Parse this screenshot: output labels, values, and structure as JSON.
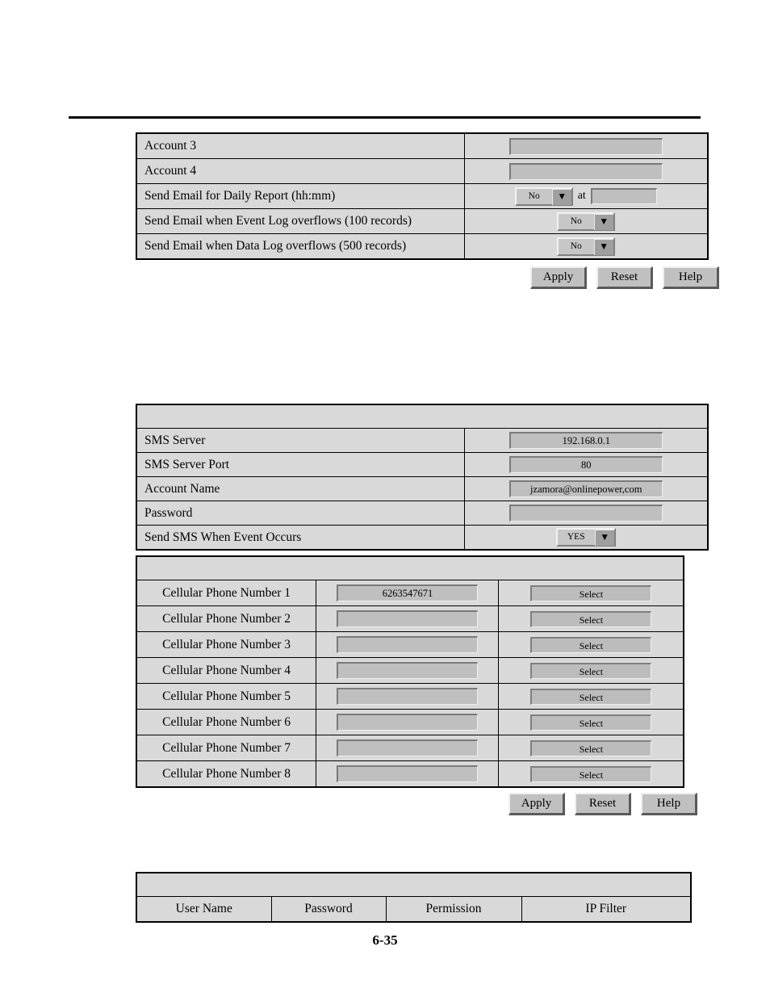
{
  "page": {
    "number": "6-35"
  },
  "email_table": {
    "rows": [
      {
        "label": "Account 3",
        "control": "textbox",
        "value": ""
      },
      {
        "label": "Account 4",
        "control": "textbox",
        "value": ""
      },
      {
        "label": "Send Email for Daily Report (hh:mm)",
        "control": "dropdown-time",
        "value": "No",
        "at_label": "at",
        "time_value": ""
      },
      {
        "label": "Send Email when Event Log overflows (100 records)",
        "control": "dropdown",
        "value": "No"
      },
      {
        "label": "Send Email when Data Log overflows (500 records)",
        "control": "dropdown",
        "value": "No"
      }
    ],
    "buttons": {
      "apply": "Apply",
      "reset": "Reset",
      "help": "Help"
    }
  },
  "sms_table": {
    "title": "",
    "rows": [
      {
        "label": "SMS Server",
        "control": "textbox",
        "value": "192.168.0.1"
      },
      {
        "label": "SMS Server Port",
        "control": "textbox",
        "value": "80"
      },
      {
        "label": "Account Name",
        "control": "textbox",
        "value": "jzamora@onlinepower,com"
      },
      {
        "label": "Password",
        "control": "textbox",
        "value": ""
      },
      {
        "label": "Send SMS When Event Occurs",
        "control": "dropdown",
        "value": "YES"
      }
    ]
  },
  "cellular_table": {
    "title": "",
    "select_label": "Select",
    "rows": [
      {
        "label": "Cellular Phone Number 1",
        "value": "6263547671"
      },
      {
        "label": "Cellular Phone Number 2",
        "value": ""
      },
      {
        "label": "Cellular Phone Number 3",
        "value": ""
      },
      {
        "label": "Cellular Phone Number 4",
        "value": ""
      },
      {
        "label": "Cellular Phone Number 5",
        "value": ""
      },
      {
        "label": "Cellular Phone Number 6",
        "value": ""
      },
      {
        "label": "Cellular Phone Number 7",
        "value": ""
      },
      {
        "label": "Cellular Phone Number 8",
        "value": ""
      }
    ],
    "buttons": {
      "apply": "Apply",
      "reset": "Reset",
      "help": "Help"
    }
  },
  "user_table": {
    "title": "",
    "headers": [
      "User Name",
      "Password",
      "Permission",
      "IP Filter"
    ]
  },
  "icons": {
    "dropdown_arrow": "chevron-down-icon"
  },
  "colors": {
    "table_bg": "#d9d9d9",
    "control_bg": "#bfbfbf",
    "border": "#000000"
  }
}
